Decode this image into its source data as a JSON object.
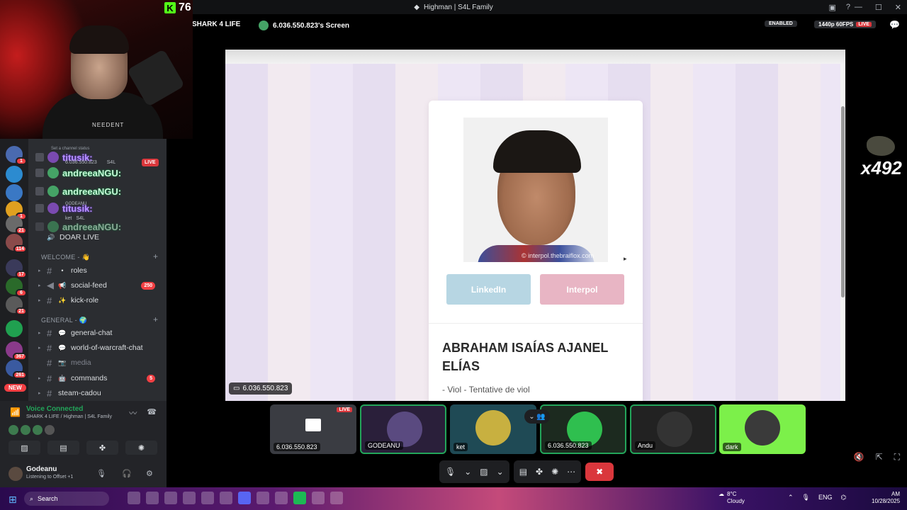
{
  "window": {
    "title": "Highman | S4L Family"
  },
  "webcam": {
    "kick_count": "76",
    "brand_text": "NEEDENT"
  },
  "servers": {
    "badges": [
      "1",
      "1",
      "21",
      "114",
      "17",
      "6",
      "21",
      "367",
      "261"
    ],
    "new_label": "NEW"
  },
  "channels": {
    "voice_rows": [
      {
        "name": "andreeaNGU:",
        "style": "green"
      },
      {
        "name": "titusik:",
        "style": "purple",
        "sub": "6.036.550.823",
        "server": "S4L"
      },
      {
        "name": "andreeaNGU:",
        "style": "green"
      },
      {
        "name": "andreeaNGU:",
        "style": "green"
      },
      {
        "name": "titusik:",
        "style": "purple",
        "sub": "GODEANU"
      },
      {
        "name": "ket",
        "server": "S4L"
      },
      {
        "name": "andreeaNGU:",
        "style": "green"
      }
    ],
    "set_status": "Set a channel status",
    "live_label": "LIVE",
    "doar_live": "DOAR LIVE",
    "welcome_category": "WELCOME - 👋",
    "welcome_channels": [
      {
        "emoji": "•",
        "name": "roles"
      },
      {
        "emoji": "📢",
        "name": "social-feed",
        "count": "250"
      },
      {
        "emoji": "✨",
        "name": "kick-role"
      }
    ],
    "general_category": "GENERAL - 🌍",
    "general_channels": [
      {
        "emoji": "💬",
        "name": "general-chat"
      },
      {
        "emoji": "💬",
        "name": "world-of-warcraft-chat"
      },
      {
        "emoji": "📷",
        "name": "media",
        "muted": true
      },
      {
        "emoji": "🤖",
        "name": "commands",
        "count": "5"
      },
      {
        "emoji": "",
        "name": "steam-cadou"
      }
    ]
  },
  "voice": {
    "status": "Voice Connected",
    "location": "SHARK 4 LIFE / Highman | S4L Family"
  },
  "user": {
    "name": "Godeanu",
    "status": "Listening to Offset +1"
  },
  "stream": {
    "server_name": "SHARK 4 LIFE",
    "screen_title": "6.036.550.823's Screen",
    "enabled_label": "ENABLED",
    "quality_label": "1440p 60FPS",
    "live_label": "LIVE",
    "streamer_label": "6.036.550.823",
    "counter": "x492"
  },
  "profile": {
    "watermark": "© interpol.thebraiflox.com",
    "linkedin_label": "LinkedIn",
    "interpol_label": "Interpol",
    "name": "ABRAHAM ISAÍAS AJANEL ELÍAS",
    "charges": "- Viol - Tentative de viol"
  },
  "tiles": [
    {
      "label": "6.036.550.823",
      "live": "LIVE",
      "kind": "screen"
    },
    {
      "label": "GODEANU",
      "kind": "avatar",
      "color": "#4a3a6a"
    },
    {
      "label": "ket",
      "kind": "avatar",
      "color": "#2e6e7a"
    },
    {
      "label": "6.036.550.823",
      "kind": "avatar",
      "color": "#2fbf4f"
    },
    {
      "label": "Andu",
      "kind": "avatar",
      "color": "#2a2a2a"
    },
    {
      "label": "dark",
      "kind": "avatar",
      "color": "#7cf04a"
    }
  ],
  "taskbar": {
    "search_placeholder": "Search",
    "weather_temp": "8°C",
    "weather_desc": "Cloudy",
    "lang": "ENG",
    "time": "AM",
    "date": "10/28/2025"
  },
  "colors": {
    "live_red": "#da373c",
    "voice_green": "#23a55a",
    "linkedin_btn": "#b7d6e3",
    "interpol_btn": "#e8b5c4",
    "kick_green": "#53fc18"
  }
}
